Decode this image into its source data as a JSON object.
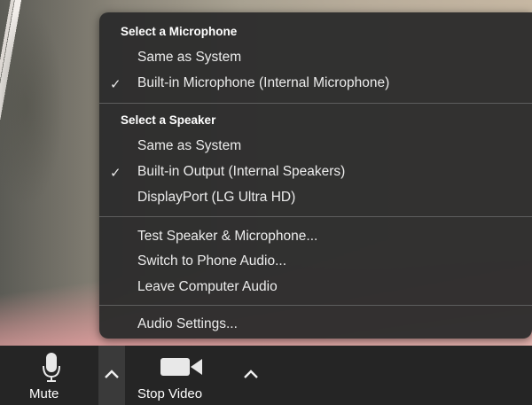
{
  "menu": {
    "microphone_header": "Select a Microphone",
    "microphone_items": [
      {
        "label": "Same as System",
        "checked": false
      },
      {
        "label": "Built-in Microphone (Internal Microphone)",
        "checked": true
      }
    ],
    "speaker_header": "Select a Speaker",
    "speaker_items": [
      {
        "label": "Same as System",
        "checked": false
      },
      {
        "label": "Built-in Output (Internal Speakers)",
        "checked": true
      },
      {
        "label": "DisplayPort (LG Ultra HD)",
        "checked": false
      }
    ],
    "actions": [
      {
        "label": "Test Speaker & Microphone..."
      },
      {
        "label": "Switch to Phone Audio..."
      },
      {
        "label": "Leave Computer Audio"
      }
    ],
    "settings": {
      "label": "Audio Settings..."
    },
    "check_glyph": "✓"
  },
  "toolbar": {
    "mute_label": "Mute",
    "stop_video_label": "Stop Video",
    "audio_caret": "^",
    "video_caret": "^"
  },
  "colors": {
    "menu_bg": "#2c2c2c",
    "toolbar_bg": "#252525",
    "text": "#ececec"
  }
}
